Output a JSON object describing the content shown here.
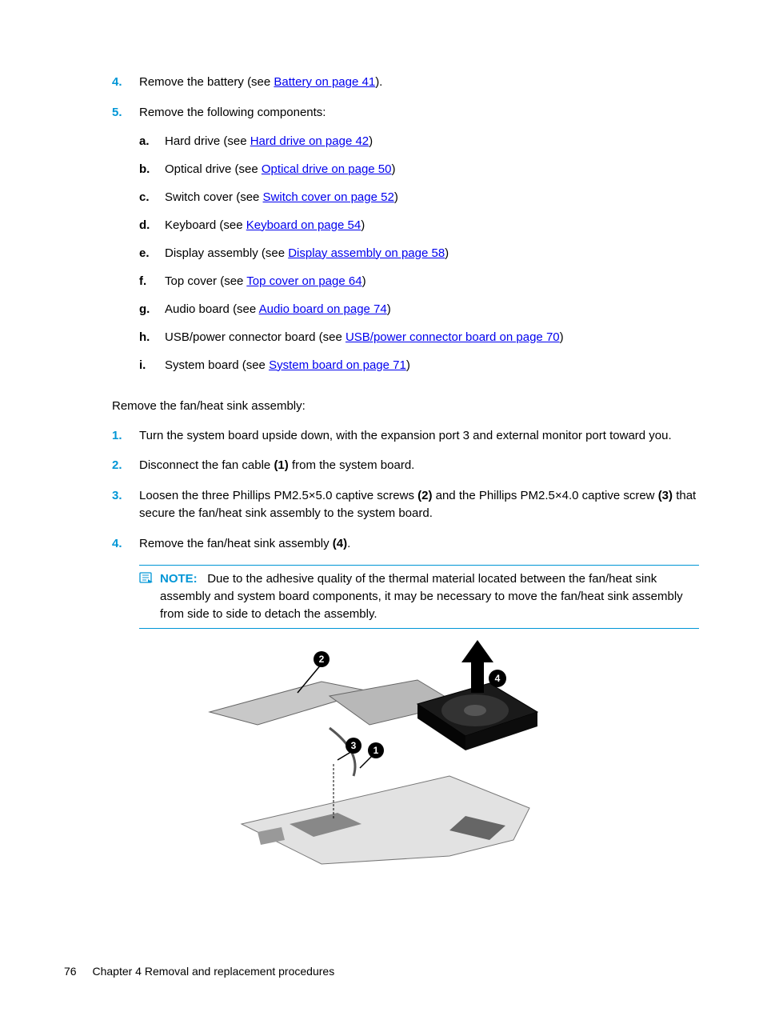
{
  "steps_a": [
    {
      "marker": "4.",
      "pre": "Remove the battery (see ",
      "link": "Battery on page 41",
      "post": ")."
    },
    {
      "marker": "5.",
      "pre": "Remove the following components:",
      "link": "",
      "post": ""
    }
  ],
  "sub_steps": [
    {
      "m": "a.",
      "pre": "Hard drive (see ",
      "link": "Hard drive on page 42",
      "post": ")"
    },
    {
      "m": "b.",
      "pre": "Optical drive (see ",
      "link": "Optical drive on page 50",
      "post": ")"
    },
    {
      "m": "c.",
      "pre": "Switch cover (see ",
      "link": "Switch cover on page 52",
      "post": ")"
    },
    {
      "m": "d.",
      "pre": "Keyboard (see ",
      "link": "Keyboard on page 54",
      "post": ")"
    },
    {
      "m": "e.",
      "pre": "Display assembly (see ",
      "link": "Display assembly on page 58",
      "post": ")"
    },
    {
      "m": "f.",
      "pre": "Top cover (see ",
      "link": "Top cover on page 64",
      "post": ")"
    },
    {
      "m": "g.",
      "pre": "Audio board (see ",
      "link": "Audio board on page 74",
      "post": ")"
    },
    {
      "m": "h.",
      "pre": "USB/power connector board (see ",
      "link": "USB/power connector board on page 70",
      "post": ")"
    },
    {
      "m": "i.",
      "pre": "System board (see ",
      "link": "System board on page 71",
      "post": ")"
    }
  ],
  "mid_para": "Remove the fan/heat sink assembly:",
  "steps_b": [
    {
      "marker": "1.",
      "html": "Turn the system board upside down, with the expansion port 3 and external monitor port toward you."
    },
    {
      "marker": "2.",
      "html": "Disconnect the fan cable <b>(1)</b> from the system board."
    },
    {
      "marker": "3.",
      "html": "Loosen the three Phillips PM2.5×5.0 captive screws <b>(2)</b> and the Phillips PM2.5×4.0 captive screw <b>(3)</b> that secure the fan/heat sink assembly to the system board."
    },
    {
      "marker": "4.",
      "html": "Remove the fan/heat sink assembly <b>(4)</b>."
    }
  ],
  "note": {
    "label": "NOTE:",
    "text": "Due to the adhesive quality of the thermal material located between the fan/heat sink assembly and system board components, it may be necessary to move the fan/heat sink assembly from side to side to detach the assembly."
  },
  "callouts": [
    "1",
    "2",
    "3",
    "4"
  ],
  "footer": {
    "page": "76",
    "chapter": "Chapter 4   Removal and replacement procedures"
  }
}
